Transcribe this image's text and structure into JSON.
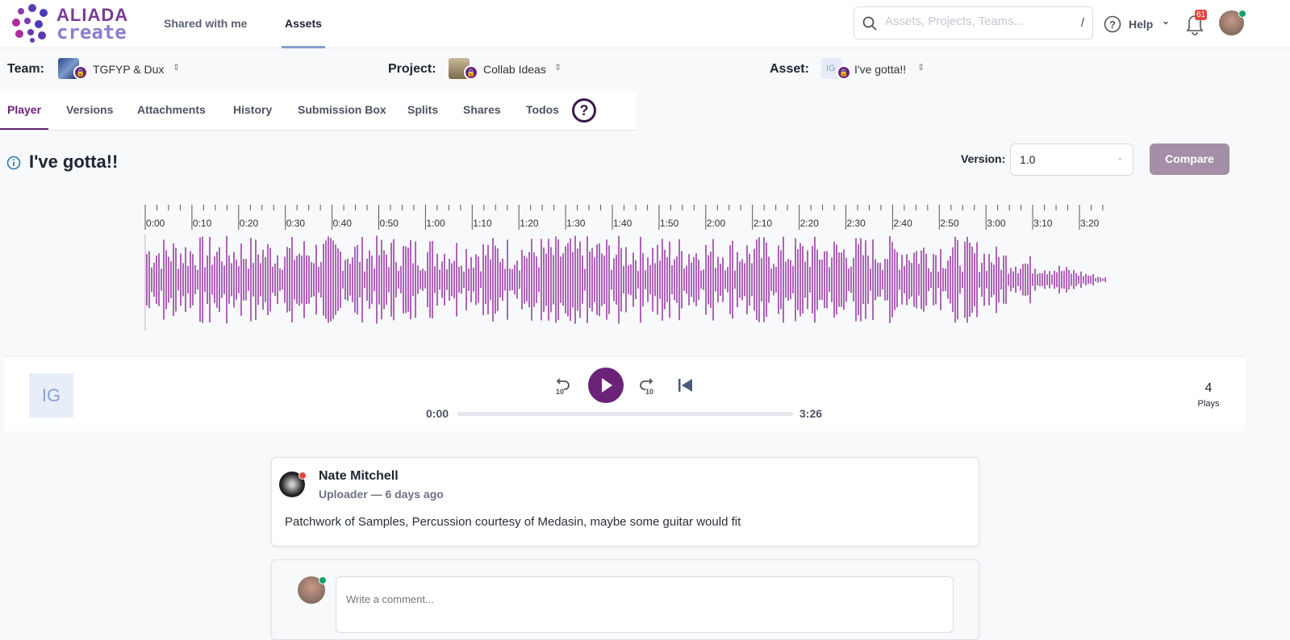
{
  "brand": {
    "line1": "ALIADA",
    "line2": "create"
  },
  "nav": {
    "shared": "Shared with me",
    "assets": "Assets"
  },
  "search": {
    "placeholder": "Assets, Projects, Teams...",
    "shortcut": "/"
  },
  "help": {
    "label": "Help"
  },
  "notifications": {
    "count": "61"
  },
  "context": {
    "team_label": "Team:",
    "team": "TGFYP & Dux",
    "project_label": "Project:",
    "project": "Collab Ideas",
    "asset_label": "Asset:",
    "asset_initials": "IG",
    "asset": "I've gotta!!"
  },
  "tabs": [
    "Player",
    "Versions",
    "Attachments",
    "History",
    "Submission Box",
    "Splits",
    "Shares",
    "Todos"
  ],
  "tabs_help": "?",
  "asset": {
    "title": "I've gotta!!",
    "version_label": "Version:",
    "version": "1.0",
    "compare": "Compare"
  },
  "timeline": [
    "0:00",
    "0:10",
    "0:20",
    "0:30",
    "0:40",
    "0:50",
    "1:00",
    "1:10",
    "1:20",
    "1:30",
    "1:40",
    "1:50",
    "2:00",
    "2:10",
    "2:20",
    "2:30",
    "2:40",
    "2:50",
    "3:00",
    "3:10",
    "3:20"
  ],
  "player": {
    "initials": "IG",
    "current": "0:00",
    "duration": "3:26",
    "progress": 0,
    "plays": "4",
    "plays_label": "Plays",
    "rewind": "10",
    "forward": "10"
  },
  "comment": {
    "author": "Nate Mitchell",
    "meta": "Uploader — 6 days ago",
    "body": "Patchwork of Samples, Percussion courtesy of Medasin, maybe some guitar would fit"
  },
  "compose": {
    "placeholder": "Write a comment..."
  },
  "colors": {
    "accent": "#6b2379",
    "wave": "#9b3fa8"
  }
}
